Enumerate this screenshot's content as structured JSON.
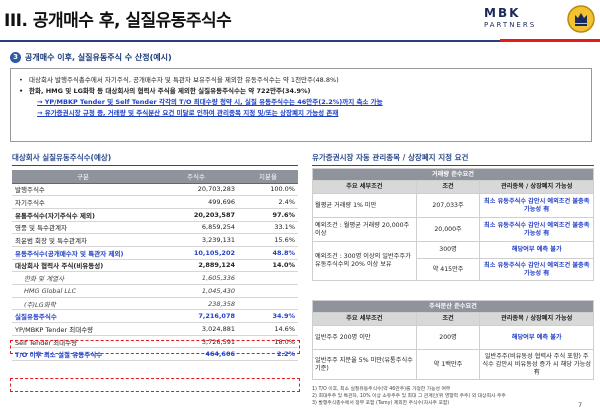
{
  "header": {
    "title": "III. 공개매수 후, 실질유동주식수",
    "logo_line1": "MBK",
    "logo_line2": "PARTNERS"
  },
  "section": {
    "number": "3",
    "title": "공개매수 이후, 실질유동주식 수 산정(예시)"
  },
  "summary": {
    "bullet1": "대상회사 발행주식총수에서 자기주식, 공개매수자 및 특관자 보유주식을 제외한 유동주식수는 약 1천만주(48.8%)",
    "bullet2": "한화, HMG 및 LG화학 등 대상회사의 협력사 주식을 제외한 실질유동주식수는 약 722만주(34.9%)",
    "arrow1": "→ YP/MBKP Tender 및 Self Tender 각각의 T/O 최대수량 청약 시, 실질 유동주식수는 46만주(2.2%)까지 축소 가능",
    "arrow2": "→ 유가증권시장 규정 중, 거래량 및 주식분산 요건 미달로 인하여 관리종목 지정 및/또는 상장폐지 가능성 존재"
  },
  "left": {
    "heading": "대상회사 실질유동주식수(예상)",
    "columns": [
      "구분",
      "주식수",
      "지분율"
    ],
    "rows": [
      {
        "label": "발행주식수",
        "shares": "20,703,283",
        "pct": "100.0%",
        "style": "normal"
      },
      {
        "label": "자기주식수",
        "shares": "499,696",
        "pct": "2.4%",
        "style": "normal"
      },
      {
        "label": "유통주식수(자기주식수 제외)",
        "shares": "20,203,587",
        "pct": "97.6%",
        "style": "bold"
      },
      {
        "label": "영풍 및 특수관계자",
        "shares": "6,859,254",
        "pct": "33.1%",
        "style": "normal"
      },
      {
        "label": "최윤범 회장 및 특수관계자",
        "shares": "3,239,131",
        "pct": "15.6%",
        "style": "normal"
      },
      {
        "label": "유동주식수(공개매수자 및 특관자 제외)",
        "shares": "10,105,202",
        "pct": "48.8%",
        "style": "blue"
      },
      {
        "label": "대상회사 협력사 주식(비유동성)",
        "shares": "2,889,124",
        "pct": "14.0%",
        "style": "bold"
      },
      {
        "label": "한화 및 계열사",
        "shares": "1,605,336",
        "pct": "",
        "style": "it"
      },
      {
        "label": "HMG Global LLC",
        "shares": "1,045,430",
        "pct": "",
        "style": "it"
      },
      {
        "label": "(주)LG화학",
        "shares": "238,358",
        "pct": "",
        "style": "it"
      },
      {
        "label": "실질유동주식수",
        "shares": "7,216,078",
        "pct": "34.9%",
        "style": "blue"
      },
      {
        "label": "YP/MBKP Tender 최대수량",
        "shares": "3,024,881",
        "pct": "14.6%",
        "style": "normal"
      },
      {
        "label": "Self Tender 최대수량",
        "shares": "3,726,591",
        "pct": "18.0%",
        "style": "normal"
      },
      {
        "label": "T/O 이후 최소 실질 유동주식수",
        "shares": "464,606",
        "pct": "2.2%",
        "style": "blue"
      }
    ]
  },
  "right": {
    "heading": "유가증권시장 자동 관리종목 / 상장폐지 지정 요건",
    "volume": {
      "title": "거래량 준수요건",
      "cols": [
        "주요 세부조건",
        "조건",
        "관리종목 / 상장폐지 가능성"
      ],
      "rows": [
        {
          "cond": "월평균 거래량 1% 미만",
          "val": "207,033주",
          "poss": "최소 유동주식수 감안시 예외조건 불충족 가능성 有"
        },
        {
          "cond": "예외조건 : 월평균 거래량 20,000주 이상",
          "val": "20,000주",
          "poss": "최소 유동주식수 감안시 예외조건 불충족 가능성 有"
        },
        {
          "cond": "예외조건 : 300명 이상의 일반주주가 유동주식수의 20% 이상 보유",
          "val_a": "300명",
          "val_b": "약 415만주",
          "poss_a": "해당여부 예측 불가",
          "poss_b": "최소 유동주식수 감안시 예외조건 불충족 가능성 有"
        }
      ]
    },
    "dispersion": {
      "title": "주식분산 준수요건",
      "cols": [
        "주요 세부조건",
        "조건",
        "관리종목 / 상장폐지 가능성"
      ],
      "rows": [
        {
          "cond": "일반주주 200명 이만",
          "val": "200명",
          "poss": "해당여부 예측 불가"
        },
        {
          "cond": "일반주주 지분율 5% 미만(유통주식수 기준)",
          "val": "약 1백만주",
          "poss": "일반주주(비유동성 협력사 주식 포함) 주식수 감안시 비유동성 증가 시 해당 가능성 有"
        }
      ]
    },
    "notes": [
      "1) T/O 이후, 최소 실질유동주식수(약 46만주)를 가정한 가능성 여부",
      "2) 최대주주 및 특관자, 10% 이상 소유주주 및 최대 그 관계인(위 영향력 주주) 외 대상회사 주주",
      "3) 발행주식총수에서 정부 포함 (Tamy) 제외한 주식수(자사주 포함)"
    ]
  },
  "page_number": "7"
}
